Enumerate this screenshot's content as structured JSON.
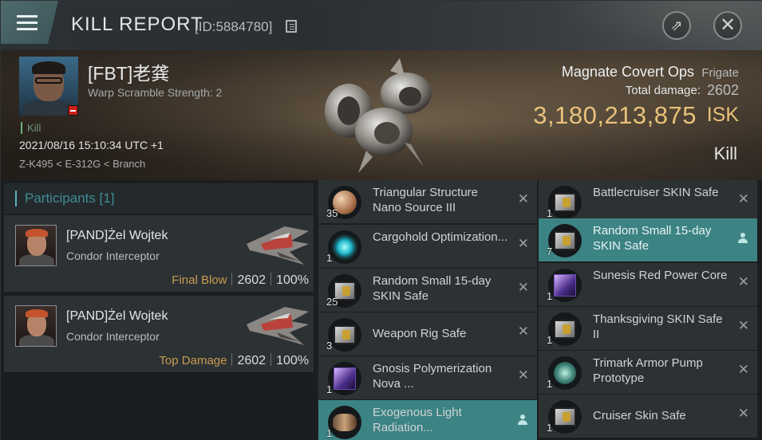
{
  "window": {
    "title": "KILL REPORT",
    "report_id": "[ID:5884780]",
    "share_glyph": "⇗",
    "close_glyph": "✕"
  },
  "victim": {
    "name": "[FBT]老龚",
    "warp_scramble": "Warp Scramble Strength: 2",
    "tag": "Kill",
    "datetime": "2021/08/16 15:10:34 UTC +1",
    "location": "Z-K495 < E-312G < Branch",
    "ship_name": "Magnate Covert Ops",
    "ship_class": "Frigate",
    "total_damage_label": "Total damage:",
    "total_damage": "2602",
    "isk_value": "3,180,213,875",
    "isk_unit": "ISK",
    "result": "Kill"
  },
  "participants": {
    "header": "Participants [1]",
    "rows": [
      {
        "name": "[PAND]Żel Wojtek",
        "ship": "Condor Interceptor",
        "label": "Final Blow",
        "damage": "2602",
        "percent": "100%"
      },
      {
        "name": "[PAND]Żel Wojtek",
        "ship": "Condor Interceptor",
        "label": "Top Damage",
        "damage": "2602",
        "percent": "100%"
      }
    ]
  },
  "items": {
    "left": [
      {
        "qty": "35",
        "name": "Triangular Structure Nano Source III",
        "icon": "sphere-icon",
        "highlight": false
      },
      {
        "qty": "1",
        "name": "Cargohold Optimization...",
        "icon": "rig-icon",
        "highlight": false
      },
      {
        "qty": "25",
        "name": "Random Small 15-day SKIN Safe",
        "icon": "crate-icon",
        "highlight": false
      },
      {
        "qty": "3",
        "name": "Weapon Rig Safe",
        "icon": "crate-icon",
        "highlight": false
      },
      {
        "qty": "1",
        "name": "Gnosis Polymerization Nova ...",
        "icon": "skin-icon",
        "highlight": false
      },
      {
        "qty": "1",
        "name": "Exogenous Light Radiation...",
        "icon": "module-icon",
        "highlight": true
      }
    ],
    "right": [
      {
        "qty": "1",
        "name": "Battlecruiser SKIN Safe",
        "icon": "crate-icon",
        "highlight": false
      },
      {
        "qty": "7",
        "name": "Random Small 15-day SKIN Safe",
        "icon": "crate-icon",
        "highlight": true
      },
      {
        "qty": "1",
        "name": "Sunesis Red Power Core",
        "icon": "skin-icon",
        "highlight": false
      },
      {
        "qty": "1",
        "name": "Thanksgiving SKIN Safe II",
        "icon": "crate-icon",
        "highlight": false
      },
      {
        "qty": "1",
        "name": "Trimark Armor Pump Prototype",
        "icon": "pump-icon",
        "highlight": false
      },
      {
        "qty": "1",
        "name": "Cruiser Skin Safe",
        "icon": "crate-icon",
        "highlight": false
      }
    ]
  },
  "colors": {
    "accent_teal": "#3c8384",
    "isk_gold": "#e8c27a",
    "final_blow": "#c79c4f"
  }
}
